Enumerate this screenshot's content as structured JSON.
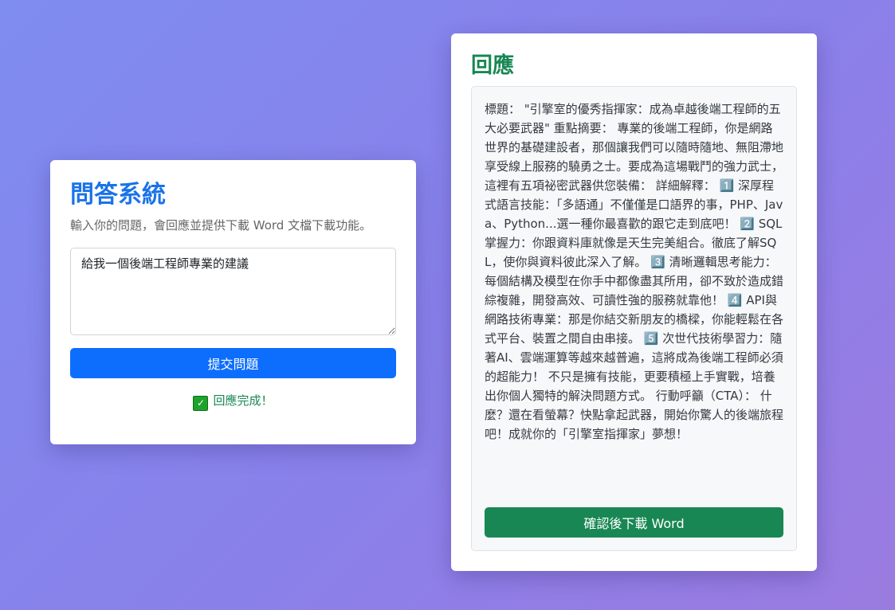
{
  "qa": {
    "title": "問答系統",
    "subtitle": "輸入你的問題，會回應並提供下載 Word 文檔下載功能。",
    "question_value": "給我一個後端工程師專業的建議",
    "submit_label": "提交問題",
    "status_text": "回應完成！",
    "status_icon": "check-mark-icon"
  },
  "response": {
    "title": "回應",
    "text": "標題： \"引擎室的優秀指揮家：成為卓越後端工程師的五大必要武器\" 重點摘要： 專業的後端工程師，你是網路世界的基礎建設者，那個讓我們可以隨時隨地、無阻滯地享受線上服務的驍勇之士。要成為這場戰鬥的強力武士，這裡有五項祕密武器供您裝備： 詳細解釋： 1️⃣ 深厚程式語言技能：「多語通」不僅僅是口語界的事，PHP、Java、Python...選一種你最喜歡的跟它走到底吧！ 2️⃣ SQL掌握力：你跟資料庫就像是天生完美組合。徹底了解SQL，使你與資料彼此深入了解。 3️⃣ 清晰邏輯思考能力：每個結構及模型在你手中都像盡其所用，卻不致於造成錯綜複雜，開發高效、可讀性強的服務就靠他！ 4️⃣ API與網路技術專業：那是你結交新朋友的橋樑，你能輕鬆在各式平台、裝置之間自由串接。 5️⃣ 次世代技術學習力：隨著AI、雲端運算等越來越普遍，這將成為後端工程師必須的超能力！ 不只是擁有技能，更要積極上手實戰，培養出你個人獨特的解決問題方式。 行動呼籲（CTA）： 什麼？還在看螢幕？快點拿起武器，開始你驚人的後端旅程吧！成就你的「引擎室指揮家」夢想！",
    "download_label": "確認後下載 Word"
  },
  "colors": {
    "qa_title": "#1a73e8",
    "response_title": "#198754",
    "submit_button": "#0d6efd",
    "download_button": "#198754",
    "status_text": "#198754"
  }
}
